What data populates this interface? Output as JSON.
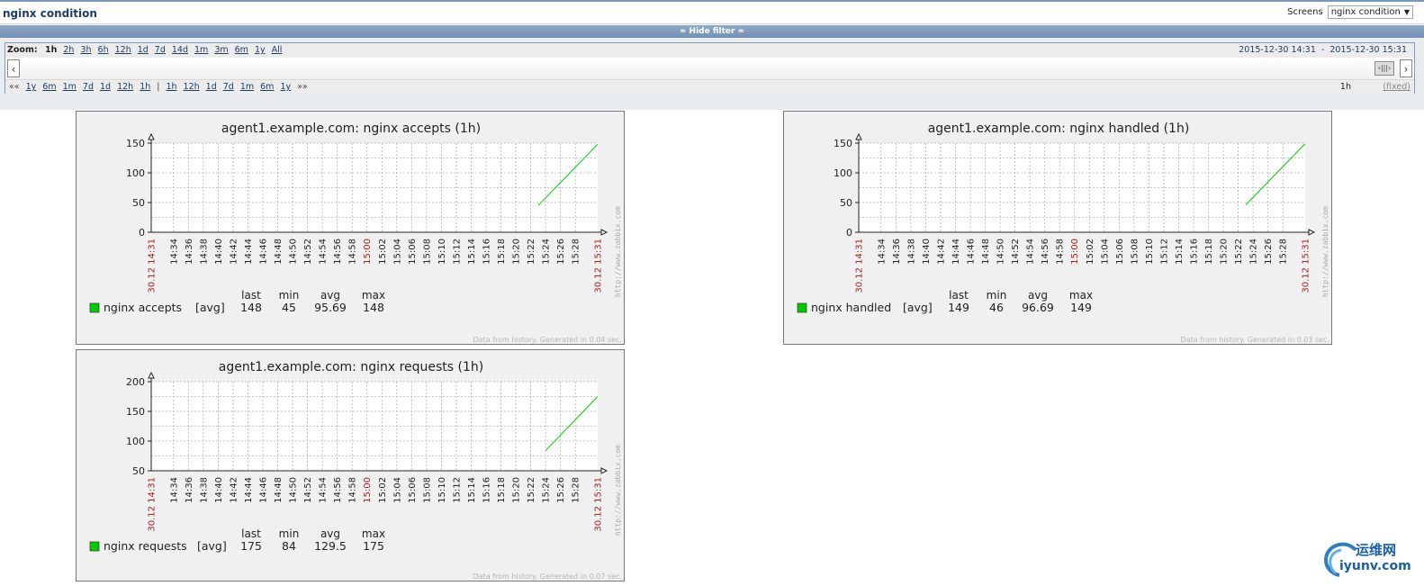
{
  "header": {
    "title": "nginx condition",
    "screens_label": "Screens",
    "screens_value": "nginx condition"
  },
  "filter": {
    "toggle_label": "Hide filter",
    "zoom_label": "Zoom:",
    "zoom_links": [
      "1h",
      "2h",
      "3h",
      "6h",
      "12h",
      "1d",
      "7d",
      "14d",
      "1m",
      "3m",
      "6m",
      "1y",
      "All"
    ],
    "active_zoom": "1h",
    "period_start": "2015-12-30 14:31",
    "period_sep": "-",
    "period_end": "2015-12-30 15:31",
    "nav_links": [
      "««",
      "1y",
      "6m",
      "1m",
      "7d",
      "1d",
      "12h",
      "1h",
      "|",
      "1h",
      "12h",
      "1d",
      "7d",
      "1m",
      "6m",
      "1y",
      "»»"
    ],
    "period_length": "1h",
    "fixed_label": "(fixed)"
  },
  "time_labels": [
    "30.12 14:31",
    "14:34",
    "14:36",
    "14:38",
    "14:40",
    "14:42",
    "14:44",
    "14:46",
    "14:48",
    "14:50",
    "14:52",
    "14:54",
    "14:56",
    "14:58",
    "15:00",
    "15:02",
    "15:04",
    "15:06",
    "15:08",
    "15:10",
    "15:12",
    "15:14",
    "15:16",
    "15:18",
    "15:20",
    "15:22",
    "15:24",
    "15:26",
    "15:28",
    "30.12 15:31"
  ],
  "watermark": "http://www.zabbix.com",
  "legend_header": {
    "last": "last",
    "min": "min",
    "avg": "avg",
    "max": "max"
  },
  "graphs": [
    {
      "title": "agent1.example.com: nginx accepts (1h)",
      "legend": {
        "name": "nginx accepts",
        "func": "[avg]",
        "last": "148",
        "min": "45",
        "avg": "95.69",
        "max": "148"
      },
      "footer": "Data from history. Generated in 0.04 sec.",
      "color": "#00cc00"
    },
    {
      "title": "agent1.example.com: nginx handled (1h)",
      "legend": {
        "name": "nginx handled",
        "func": "[avg]",
        "last": "149",
        "min": "46",
        "avg": "96.69",
        "max": "149"
      },
      "footer": "Data from history. Generated in 0.03 sec.",
      "color": "#00cc00"
    },
    {
      "title": "agent1.example.com: nginx requests (1h)",
      "legend": {
        "name": "nginx requests",
        "func": "[avg]",
        "last": "175",
        "min": "84",
        "avg": "129.5",
        "max": "175"
      },
      "footer": "Data from history. Generated in 0.07 sec.",
      "color": "#00cc00"
    }
  ],
  "chart_data": [
    {
      "type": "line",
      "title": "agent1.example.com: nginx accepts (1h)",
      "y_ticks": [
        0,
        50,
        100,
        150
      ],
      "ylim": [
        0,
        150
      ],
      "series": [
        {
          "name": "nginx accepts",
          "x": [
            "15:23",
            "15:31"
          ],
          "values": [
            45,
            148
          ]
        }
      ]
    },
    {
      "type": "line",
      "title": "agent1.example.com: nginx handled (1h)",
      "y_ticks": [
        0,
        50,
        100,
        150
      ],
      "ylim": [
        0,
        150
      ],
      "series": [
        {
          "name": "nginx handled",
          "x": [
            "15:23",
            "15:31"
          ],
          "values": [
            46,
            149
          ]
        }
      ]
    },
    {
      "type": "line",
      "title": "agent1.example.com: nginx requests (1h)",
      "y_ticks": [
        50,
        100,
        150,
        200
      ],
      "ylim": [
        50,
        200
      ],
      "series": [
        {
          "name": "nginx requests",
          "x": [
            "15:24",
            "15:31"
          ],
          "values": [
            84,
            175
          ]
        }
      ]
    }
  ],
  "logo": {
    "text_cn": "运维网",
    "text_en": "iyunv.com"
  }
}
